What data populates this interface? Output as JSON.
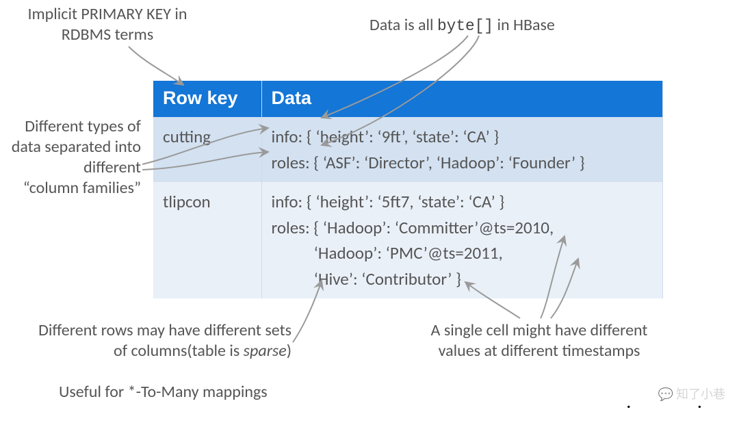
{
  "annotations": {
    "primary_key_1": "Implicit PRIMARY KEY in",
    "primary_key_2": "RDBMS terms",
    "byte_1": "Data is all ",
    "byte_code": "byte[]",
    "byte_2": " in HBase",
    "colfam_1": "Different types of",
    "colfam_2": "data separated into",
    "colfam_3": "different",
    "colfam_4": "“column families”",
    "sparse_1": "Different rows may have different sets",
    "sparse_2a": "of columns(table is ",
    "sparse_2b": "sparse",
    "sparse_2c": ")",
    "useful": "Useful for *-To-Many mappings",
    "timestamps_1": "A single cell might have different",
    "timestamps_2": "values at different timestamps"
  },
  "table": {
    "headers": {
      "rowkey": "Row key",
      "data": "Data"
    },
    "rows": [
      {
        "key": "cutting",
        "lines": [
          "info: { ‘height’: ‘9ft’, ‘state’: ‘CA’ }",
          "roles: { ‘ASF’: ‘Director’, ‘Hadoop’: ‘Founder’ }"
        ]
      },
      {
        "key": "tlipcon",
        "lines": [
          "info: { ‘height’: ‘5ft7, ‘state’: ‘CA’ }",
          "roles: { ‘Hadoop’: ‘Committer’@ts=2010,",
          "           ‘Hadoop’: ‘PMC’@ts=2011,",
          "           ‘Hive’: ‘Contributor’ }"
        ]
      }
    ]
  },
  "watermark": "知了小巷"
}
